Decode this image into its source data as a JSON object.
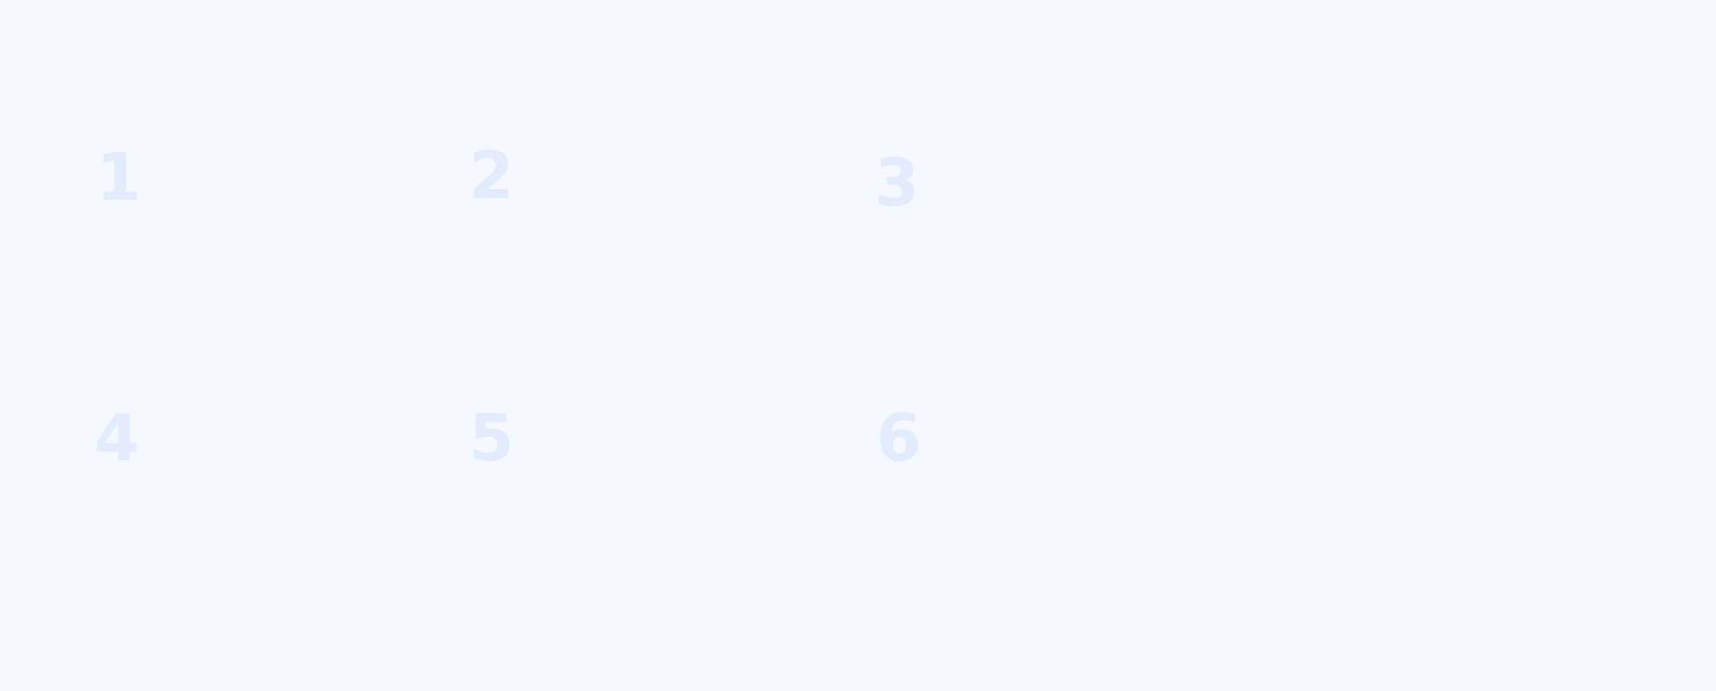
{
  "grid": {
    "items": [
      {
        "label": "1"
      },
      {
        "label": "2"
      },
      {
        "label": "3"
      },
      {
        "label": "4"
      },
      {
        "label": "5"
      },
      {
        "label": "6"
      }
    ],
    "text_color": "#e2ecfd",
    "background_color": "#f5f9ff"
  }
}
